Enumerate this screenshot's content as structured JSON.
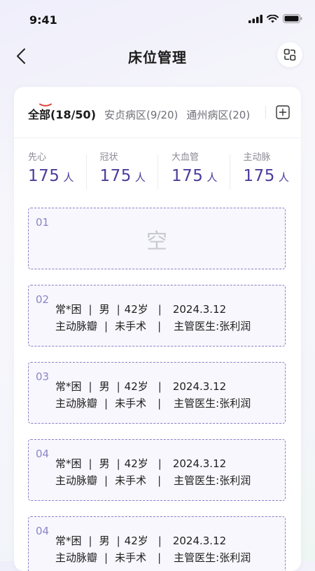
{
  "status_bar": {
    "time": "9:41"
  },
  "nav": {
    "title": "床位管理",
    "back_icon": "chevron-left-icon",
    "action_icon": "swap-scan-icon"
  },
  "tabs": [
    {
      "label": "全部(18/50)",
      "active": true
    },
    {
      "label": "安贞病区(9/20)",
      "active": false
    },
    {
      "label": "通州病区(20)",
      "active": false
    }
  ],
  "add_tab_icon": "plus-square-icon",
  "stats": [
    {
      "label": "先心",
      "value": "175",
      "unit": "人"
    },
    {
      "label": "冠状",
      "value": "175",
      "unit": "人"
    },
    {
      "label": "大血管",
      "value": "175",
      "unit": "人"
    },
    {
      "label": "主动脉",
      "value": "175",
      "unit": "人"
    }
  ],
  "beds": [
    {
      "number": "01",
      "empty_text": "空"
    },
    {
      "number": "02",
      "name": "常*困",
      "gender": "男",
      "age": "42岁",
      "date": "2024.3.12",
      "diagnosis": "主动脉瓣",
      "surgery": "未手术",
      "doctor": "主管医生:张利润"
    },
    {
      "number": "03",
      "name": "常*困",
      "gender": "男",
      "age": "42岁",
      "date": "2024.3.12",
      "diagnosis": "主动脉瓣",
      "surgery": "未手术",
      "doctor": "主管医生:张利润"
    },
    {
      "number": "04",
      "name": "常*困",
      "gender": "男",
      "age": "42岁",
      "date": "2024.3.12",
      "diagnosis": "主动脉瓣",
      "surgery": "未手术",
      "doctor": "主管医生:张利润"
    },
    {
      "number": "04",
      "name": "常*困",
      "gender": "男",
      "age": "42岁",
      "date": "2024.3.12",
      "diagnosis": "主动脉瓣",
      "surgery": "未手术",
      "doctor": "主管医生:张利润"
    }
  ],
  "colors": {
    "accent": "#4b3d9a",
    "dashed_border": "#8a80c8",
    "tab_underline": "#e0443a"
  }
}
